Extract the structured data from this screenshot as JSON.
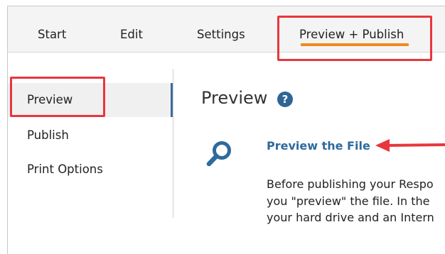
{
  "tabs": {
    "start": "Start",
    "edit": "Edit",
    "settings": "Settings",
    "preview_publish": "Preview + Publish"
  },
  "sidebar": {
    "items": [
      {
        "label": "Preview",
        "selected": true
      },
      {
        "label": "Publish",
        "selected": false
      },
      {
        "label": "Print Options",
        "selected": false
      }
    ]
  },
  "main": {
    "title": "Preview",
    "help_icon": "help-circle-icon",
    "section_icon": "search-icon",
    "section_link": "Preview the File",
    "description_lines": [
      "Before publishing your Respo",
      "you \"preview\" the file.  In the",
      "your hard drive and an Intern"
    ]
  },
  "colors": {
    "accent_underline": "#f08a1c",
    "annotation_red": "#e8363d",
    "link_blue": "#2e6a9c",
    "sidebar_indicator": "#3a6d9c"
  }
}
